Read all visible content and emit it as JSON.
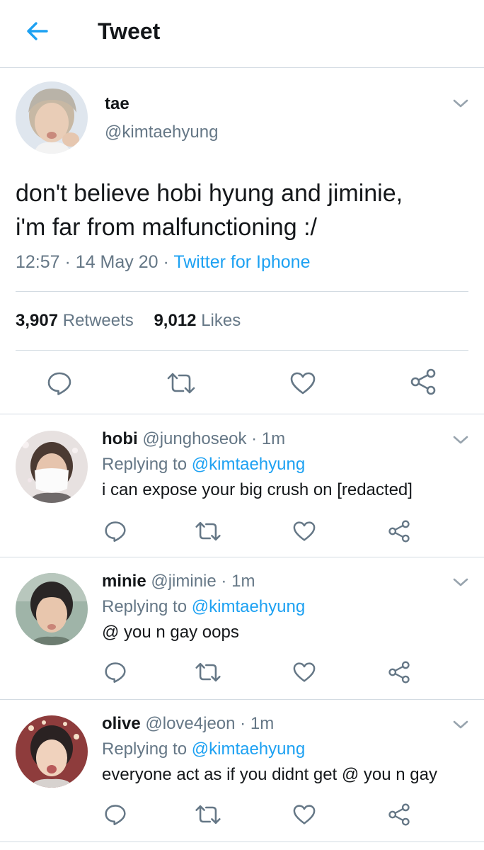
{
  "header": {
    "title": "Tweet",
    "back_icon": "arrow-left-icon"
  },
  "tweet": {
    "name": "tae",
    "handle": "@kimtaehyung",
    "text_line1": "don't believe hobi hyung and jiminie,",
    "text_line2": "i'm far from malfunctioning :/",
    "time": "12:57",
    "date": "14 May 20",
    "separator": "·",
    "source": "Twitter for Iphone",
    "retweets_count": "3,907",
    "retweets_label": "Retweets",
    "likes_count": "9,012",
    "likes_label": "Likes"
  },
  "replies": [
    {
      "name": "hobi",
      "handle": "@junghoseok",
      "time": "1m",
      "replying_label": "Replying to",
      "replying_to": "@kimtaehyung",
      "text": "i can expose your big crush on [redacted]"
    },
    {
      "name": "minie",
      "handle": "@jiminie",
      "time": "1m",
      "replying_label": "Replying to",
      "replying_to": "@kimtaehyung",
      "text": "@ you n gay oops"
    },
    {
      "name": "olive",
      "handle": "@love4jeon",
      "time": "1m",
      "replying_label": "Replying to",
      "replying_to": "@kimtaehyung",
      "text": "everyone act as if you didnt get @ you n gay"
    }
  ],
  "colors": {
    "accent": "#1da1f2",
    "muted": "#657786",
    "text": "#14171a",
    "border": "#d3dbe2"
  },
  "icons": [
    "arrow-left-icon",
    "chevron-down-icon",
    "reply-icon",
    "retweet-icon",
    "heart-icon",
    "share-icon"
  ]
}
